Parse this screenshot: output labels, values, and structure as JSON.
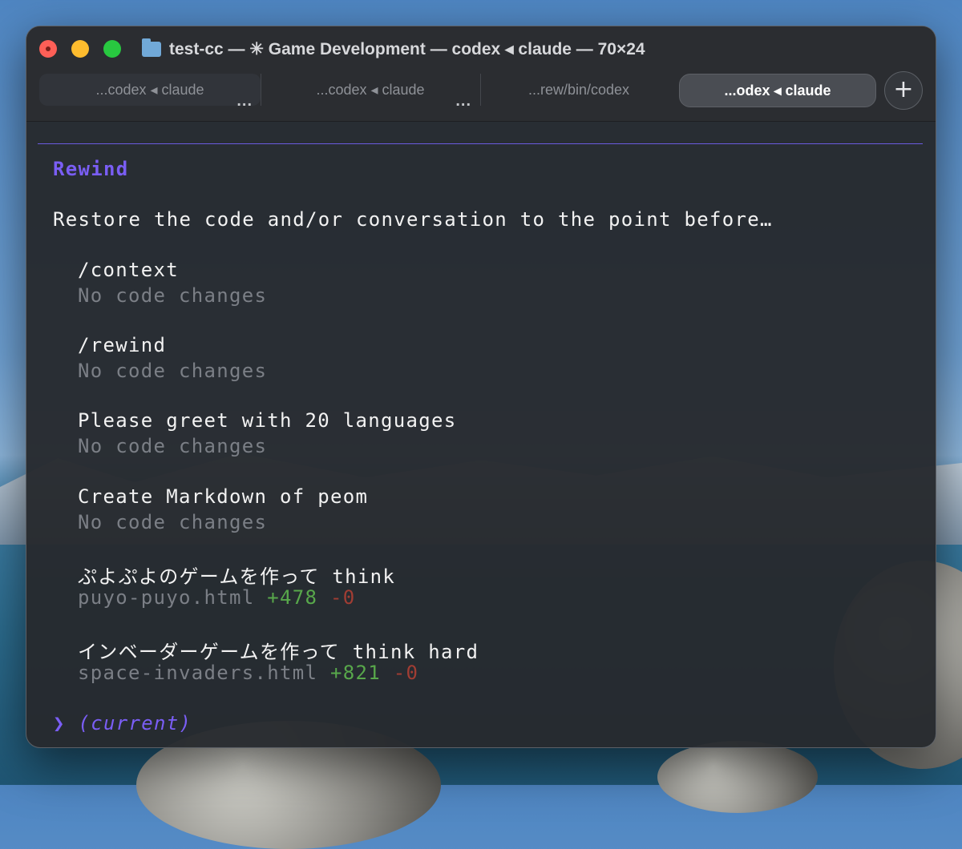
{
  "window": {
    "title": "test-cc — ✳ Game Development — codex ◂ claude — 70×24"
  },
  "tabs": [
    {
      "label": "...codex ◂ claude",
      "active": false,
      "more": "..."
    },
    {
      "label": "...codex ◂ claude",
      "active": false,
      "more": "..."
    },
    {
      "label": "...rew/bin/codex",
      "active": false
    },
    {
      "label": "...odex ◂ claude",
      "active": true
    }
  ],
  "new_tab_label": "+",
  "rewind": {
    "heading": "Rewind",
    "prompt": "Restore the code and/or conversation to the point before…",
    "items": [
      {
        "label": "/context",
        "detail": "No code changes"
      },
      {
        "label": "/rewind",
        "detail": "No code changes"
      },
      {
        "label": "Please greet with 20 languages",
        "detail": "No code changes"
      },
      {
        "label": "Create Markdown of peom",
        "detail": "No code changes"
      },
      {
        "label": "ぷよぷよのゲームを作って think",
        "file": "puyo-puyo.html",
        "added": "+478",
        "removed": "-0"
      },
      {
        "label": "インベーダーゲームを作って think hard",
        "file": "space-invaders.html",
        "added": "+821",
        "removed": "-0"
      }
    ],
    "current_marker": "❯",
    "current_label": "(current)"
  },
  "colors": {
    "accent": "#7a5ef5",
    "added": "#58a84b",
    "removed": "#a13d33",
    "dim": "#7b7f86"
  }
}
